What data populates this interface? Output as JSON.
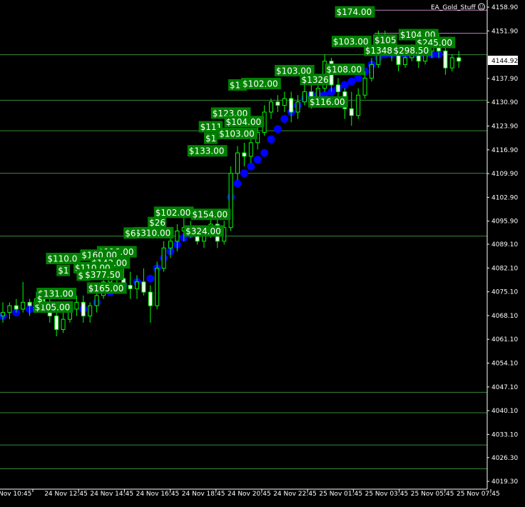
{
  "expert_label": "EA_Gold_Stuff",
  "smiley_icon": "smiley-face-icon",
  "colors": {
    "background": "#000000",
    "grid": "#3a8a3a",
    "axis": "#ffffff",
    "candle_wick": "#00ff00",
    "candle_bull": "#000000",
    "candle_bear": "#ffffff",
    "trend_dot": "#0000ff",
    "profit_label_bg": "#008000",
    "profit_label_text": "#ffffff",
    "current_price_bg": "#ffffff",
    "target_line": "#c080c0"
  },
  "chart_data": {
    "type": "candlestick",
    "symbol_text": "EA_Gold_Stuff",
    "ylim": [
      4017,
      4161
    ],
    "y_ticks": [
      "4158.90",
      "4151.90",
      "4144.92",
      "4137.90",
      "4130.90",
      "4123.90",
      "4116.90",
      "4109.90",
      "4102.90",
      "4095.90",
      "4089.10",
      "4082.10",
      "4075.10",
      "4068.10",
      "4061.10",
      "4054.10",
      "4047.10",
      "4040.10",
      "4033.10",
      "4026.30",
      "4019.30"
    ],
    "current_price": "4144.92",
    "x_ticks": [
      "Nov 10:45",
      "24 Nov 12:45",
      "24 Nov 14:45",
      "24 Nov 16:45",
      "24 Nov 18:45",
      "24 Nov 20:45",
      "24 Nov 22:45",
      "25 Nov 01:45",
      "25 Nov 03:45",
      "25 Nov 05:45",
      "25 Nov 07:45"
    ],
    "horizontal_levels": [
      4144.9,
      4131.5,
      4122.5,
      4110.0,
      4091.5,
      4045.5,
      4039.5,
      4030.0,
      4023.0
    ],
    "target_levels": [
      4158.0,
      4151.2
    ],
    "candles": [
      [
        0,
        4068,
        4072,
        4066,
        4069
      ],
      [
        1,
        4069,
        4072,
        4067,
        4071
      ],
      [
        2,
        4071,
        4073,
        4069,
        4070
      ],
      [
        3,
        4070,
        4078,
        4069,
        4072
      ],
      [
        4,
        4072,
        4073,
        4068,
        4071
      ],
      [
        5,
        4071,
        4075,
        4070,
        4073
      ],
      [
        6,
        4073,
        4074,
        4070,
        4071
      ],
      [
        7,
        4071,
        4073,
        4066,
        4068
      ],
      [
        8,
        4068,
        4071,
        4062,
        4064
      ],
      [
        9,
        4064,
        4069,
        4063,
        4067
      ],
      [
        10,
        4067,
        4071,
        4066,
        4070
      ],
      [
        11,
        4070,
        4074,
        4068,
        4072
      ],
      [
        12,
        4072,
        4074,
        4066,
        4068
      ],
      [
        13,
        4068,
        4072,
        4066,
        4071
      ],
      [
        14,
        4071,
        4076,
        4069,
        4074
      ],
      [
        15,
        4074,
        4080,
        4073,
        4078
      ],
      [
        16,
        4078,
        4083,
        4076,
        4081
      ],
      [
        17,
        4081,
        4085,
        4077,
        4079
      ],
      [
        18,
        4079,
        4083,
        4075,
        4077
      ],
      [
        19,
        4077,
        4081,
        4073,
        4076
      ],
      [
        20,
        4076,
        4080,
        4073,
        4078
      ],
      [
        21,
        4078,
        4082,
        4074,
        4075
      ],
      [
        22,
        4075,
        4077,
        4066,
        4071
      ],
      [
        23,
        4071,
        4084,
        4070,
        4082
      ],
      [
        24,
        4082,
        4090,
        4081,
        4088
      ],
      [
        25,
        4088,
        4093,
        4085,
        4090
      ],
      [
        26,
        4090,
        4095,
        4087,
        4093
      ],
      [
        27,
        4093,
        4097,
        4090,
        4094
      ],
      [
        28,
        4094,
        4096,
        4091,
        4092
      ],
      [
        29,
        4092,
        4094,
        4089,
        4090
      ],
      [
        30,
        4090,
        4094,
        4088,
        4093
      ],
      [
        31,
        4093,
        4097,
        4091,
        4095
      ],
      [
        32,
        4095,
        4097,
        4088,
        4090
      ],
      [
        33,
        4090,
        4096,
        4089,
        4094
      ],
      [
        34,
        4094,
        4112,
        4093,
        4110
      ],
      [
        35,
        4110,
        4118,
        4108,
        4116
      ],
      [
        36,
        4116,
        4119,
        4112,
        4115
      ],
      [
        37,
        4115,
        4121,
        4113,
        4119
      ],
      [
        38,
        4119,
        4124,
        4117,
        4122
      ],
      [
        39,
        4122,
        4130,
        4121,
        4128
      ],
      [
        40,
        4128,
        4132,
        4126,
        4131
      ],
      [
        41,
        4131,
        4133,
        4128,
        4130
      ],
      [
        42,
        4130,
        4134,
        4128,
        4132
      ],
      [
        43,
        4132,
        4134,
        4125,
        4128
      ],
      [
        44,
        4128,
        4133,
        4126,
        4131
      ],
      [
        45,
        4131,
        4136,
        4130,
        4134
      ],
      [
        46,
        4134,
        4137,
        4129,
        4131
      ],
      [
        47,
        4131,
        4136,
        4130,
        4135
      ],
      [
        48,
        4135,
        4145,
        4134,
        4143
      ],
      [
        49,
        4143,
        4144,
        4134,
        4136
      ],
      [
        50,
        4136,
        4138,
        4130,
        4134
      ],
      [
        51,
        4134,
        4135,
        4126,
        4129
      ],
      [
        52,
        4129,
        4134,
        4124,
        4127
      ],
      [
        53,
        4127,
        4135,
        4126,
        4133
      ],
      [
        54,
        4133,
        4140,
        4132,
        4138
      ],
      [
        55,
        4138,
        4144,
        4137,
        4142
      ],
      [
        56,
        4142,
        4152,
        4141,
        4150
      ],
      [
        57,
        4150,
        4152,
        4145,
        4147
      ],
      [
        58,
        4147,
        4149,
        4143,
        4145
      ],
      [
        59,
        4145,
        4147,
        4140,
        4142
      ],
      [
        60,
        4142,
        4146,
        4141,
        4144
      ],
      [
        61,
        4144,
        4148,
        4143,
        4146
      ],
      [
        62,
        4146,
        4148,
        4141,
        4143
      ],
      [
        63,
        4143,
        4147,
        4142,
        4146
      ],
      [
        64,
        4146,
        4152,
        4144,
        4150
      ],
      [
        65,
        4150,
        4151,
        4144,
        4146
      ],
      [
        66,
        4146,
        4147,
        4139,
        4141
      ],
      [
        67,
        4141,
        4145,
        4140,
        4144
      ],
      [
        68,
        4144,
        4146,
        4141,
        4143
      ]
    ],
    "trend_dots": [
      [
        0,
        4068
      ],
      [
        2,
        4069
      ],
      [
        4,
        4070
      ],
      [
        6,
        4070
      ],
      [
        8,
        4070
      ],
      [
        10,
        4070
      ],
      [
        12,
        4070
      ],
      [
        14,
        4072
      ],
      [
        16,
        4075
      ],
      [
        18,
        4077
      ],
      [
        20,
        4078
      ],
      [
        22,
        4079
      ],
      [
        23,
        4082
      ],
      [
        24,
        4085
      ],
      [
        25,
        4087
      ],
      [
        26,
        4089
      ],
      [
        27,
        4091
      ],
      [
        28,
        4092
      ],
      [
        29,
        4093
      ],
      [
        30,
        4093
      ],
      [
        31,
        4093
      ],
      [
        32,
        4094
      ],
      [
        33,
        4098
      ],
      [
        34,
        4103
      ],
      [
        35,
        4107
      ],
      [
        36,
        4110
      ],
      [
        37,
        4112
      ],
      [
        38,
        4114
      ],
      [
        39,
        4116
      ],
      [
        40,
        4120
      ],
      [
        41,
        4123
      ],
      [
        42,
        4126
      ],
      [
        43,
        4128
      ],
      [
        44,
        4130
      ],
      [
        45,
        4132
      ],
      [
        46,
        4133
      ],
      [
        47,
        4133
      ],
      [
        48,
        4133
      ],
      [
        49,
        4134
      ],
      [
        50,
        4135
      ],
      [
        51,
        4136
      ],
      [
        52,
        4137
      ],
      [
        53,
        4138
      ],
      [
        54,
        4140
      ],
      [
        55,
        4142
      ],
      [
        56,
        4144
      ],
      [
        57,
        4145
      ],
      [
        58,
        4145
      ],
      [
        59,
        4145
      ],
      [
        60,
        4145
      ],
      [
        61,
        4145
      ],
      [
        62,
        4145
      ],
      [
        63,
        4145
      ],
      [
        64,
        4145
      ],
      [
        65,
        4145
      ]
    ],
    "profit_labels": [
      {
        "text": "$174.00",
        "i": 52.5,
        "p": 4157.5
      },
      {
        "text": "$103.00",
        "i": 52.0,
        "p": 4148.8
      },
      {
        "text": "$105",
        "i": 57.0,
        "p": 4149.2
      },
      {
        "text": "$104.00",
        "i": 62.0,
        "p": 4150.8
      },
      {
        "text": "$245.00",
        "i": 64.5,
        "p": 4148.5
      },
      {
        "text": "$1348",
        "i": 56.0,
        "p": 4146.2
      },
      {
        "text": "$298.50",
        "i": 61.0,
        "p": 4146.2
      },
      {
        "text": "$108.00",
        "i": 51.0,
        "p": 4140.6
      },
      {
        "text": "$103.00",
        "i": 43.5,
        "p": 4140.2
      },
      {
        "text": "$10",
        "i": 35.0,
        "p": 4136.0
      },
      {
        "text": "$102.00",
        "i": 38.5,
        "p": 4136.4
      },
      {
        "text": "$1326",
        "i": 46.5,
        "p": 4137.6
      },
      {
        "text": "$116.00",
        "i": 48.5,
        "p": 4131.0
      },
      {
        "text": "$123.00",
        "i": 34.0,
        "p": 4127.7
      },
      {
        "text": "$104.00",
        "i": 36.0,
        "p": 4125.2
      },
      {
        "text": "$111",
        "i": 31.0,
        "p": 4123.7
      },
      {
        "text": "$103.00",
        "i": 35.0,
        "p": 4121.7
      },
      {
        "text": "$1",
        "i": 31.0,
        "p": 4120.3
      },
      {
        "text": "$133.00",
        "i": 30.5,
        "p": 4116.6
      },
      {
        "text": "$102.00",
        "i": 25.5,
        "p": 4098.5
      },
      {
        "text": "$154.00",
        "i": 31.0,
        "p": 4097.9
      },
      {
        "text": "$1",
        "i": 23.0,
        "p": 4094.2
      },
      {
        "text": "$26",
        "i": 23.0,
        "p": 4095.5
      },
      {
        "text": "$310.00",
        "i": 22.5,
        "p": 4092.5
      },
      {
        "text": "$6",
        "i": 19.0,
        "p": 4092.4
      },
      {
        "text": "$324.00",
        "i": 30.0,
        "p": 4093.0
      },
      {
        "text": "$116.00",
        "i": 17.0,
        "p": 4086.9
      },
      {
        "text": "$160.00",
        "i": 14.5,
        "p": 4085.9
      },
      {
        "text": "$110.0",
        "i": 9.0,
        "p": 4084.9
      },
      {
        "text": "$143.00",
        "i": 16.0,
        "p": 4083.6
      },
      {
        "text": "$110.00",
        "i": 13.5,
        "p": 4082.2
      },
      {
        "text": "$1",
        "i": 9.0,
        "p": 4081.4
      },
      {
        "text": "$1",
        "i": 12.0,
        "p": 4080.0
      },
      {
        "text": "$377.50",
        "i": 15.0,
        "p": 4080.2
      },
      {
        "text": "$165.00",
        "i": 15.5,
        "p": 4076.2
      },
      {
        "text": "$131.00",
        "i": 8.0,
        "p": 4074.6
      },
      {
        "text": "$105.00",
        "i": 7.5,
        "p": 4070.6
      },
      {
        "text": "$",
        "i": 5.5,
        "p": 4073.0
      }
    ]
  }
}
